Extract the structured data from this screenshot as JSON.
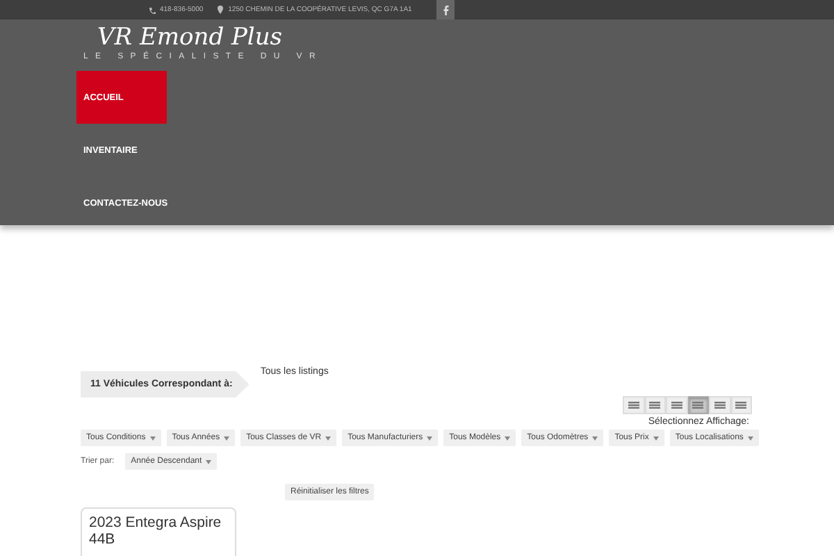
{
  "topbar": {
    "phone": "418-836-5000",
    "address": "1250 CHEMIN DE LA COOPÉRATIVE LEVIS, QC G7A 1A1"
  },
  "logo": {
    "name": "VR Emond Plus",
    "tagline": "LE SPÉCIALISTE DU VR"
  },
  "nav": [
    {
      "label": "ACCUEIL",
      "selected": true
    },
    {
      "label": "INVENTAIRE",
      "selected": false
    },
    {
      "label": "CONTACTEZ-NOUS",
      "selected": false
    }
  ],
  "results": {
    "count_label": "11 Véhicules Correspondant à:",
    "filter_text": "Tous les listings"
  },
  "views": [
    {
      "selected": false
    },
    {
      "selected": false
    },
    {
      "selected": false
    },
    {
      "selected": true
    },
    {
      "selected": false
    },
    {
      "selected": false
    }
  ],
  "views_label": "Sélectionnez Affichage:",
  "filters": [
    "Tous Conditions",
    "Tous Années",
    "Tous Classes de VR",
    "Tous Manufacturiers",
    "Tous Modèles",
    "Tous Odomètres",
    "Tous Prix",
    "Tous Localisations"
  ],
  "sort": {
    "label": "Trier par:",
    "value": "Année Descendant"
  },
  "reset_button": "Réinitialiser les filtres",
  "listings": [
    {
      "title": "2023 Entegra Aspire 44B"
    }
  ]
}
